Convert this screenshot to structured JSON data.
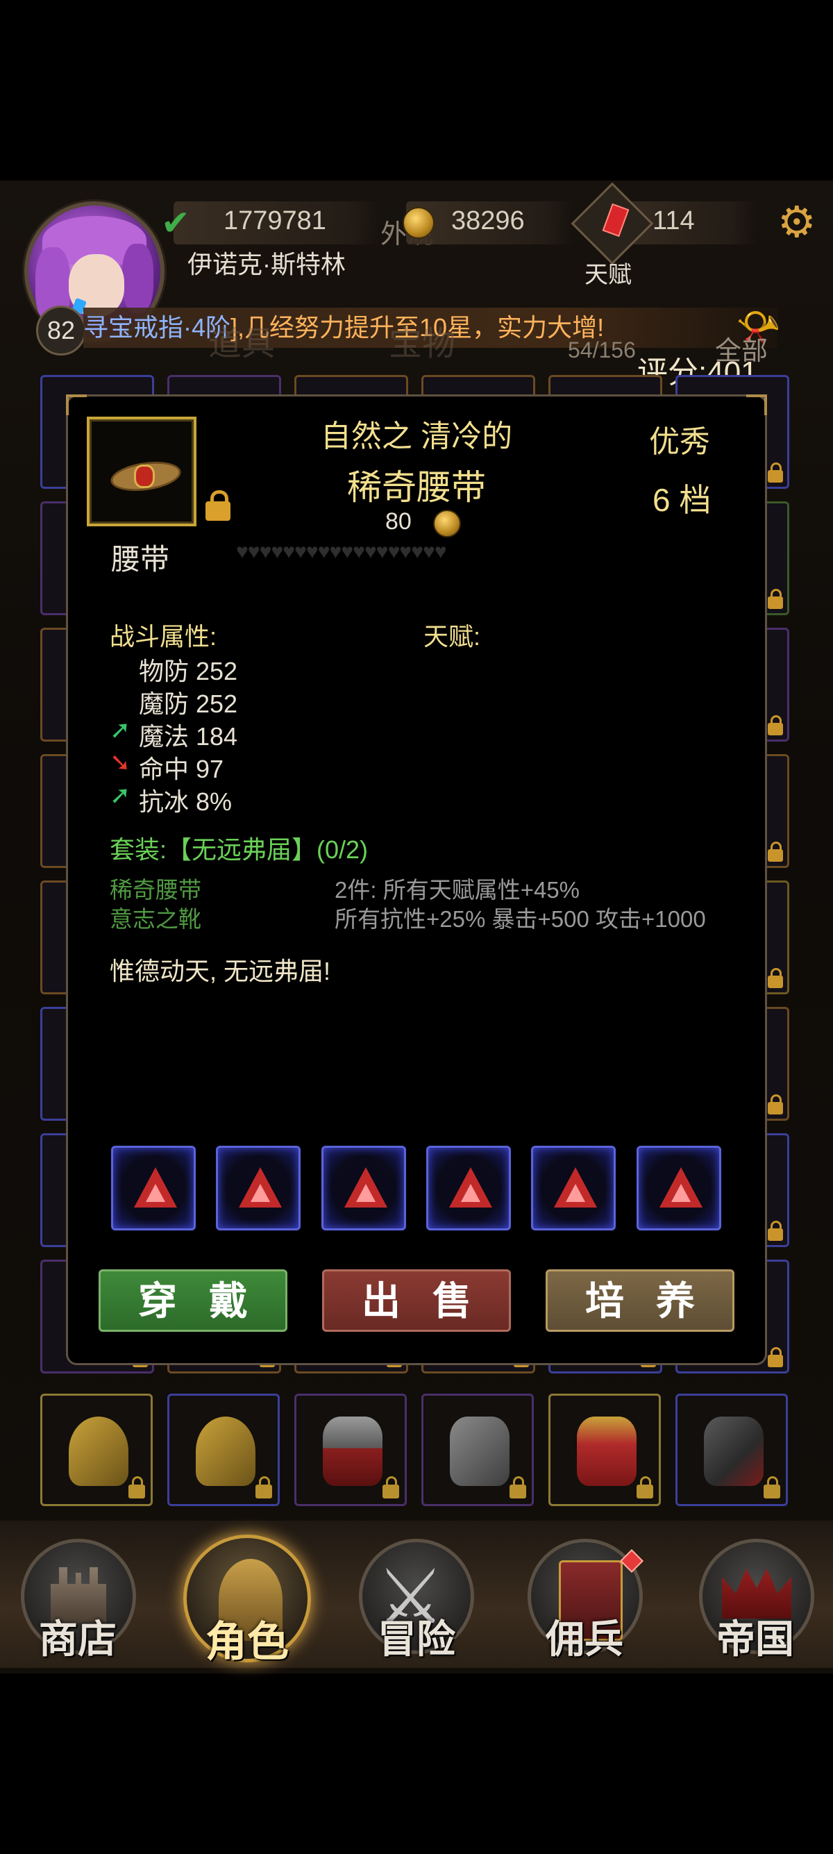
{
  "header": {
    "stamina_value": "1779781",
    "gold_value": "38296",
    "gem_value": "114",
    "player_name": "伊诺克·斯特林",
    "talent_label": "天赋",
    "level": "82",
    "ticker_part1": "寻宝戒指·4阶",
    "ticker_part2": "],几经努力提升至10星，实力大增!",
    "behind_appearance": "外观",
    "behind_tab1": "道具",
    "behind_tab2": "宝物",
    "inventory_count": "54/156",
    "filter_all": "全部",
    "score": "评分:401"
  },
  "item": {
    "prefix": "自然之 清冷的",
    "name": "稀奇腰带",
    "price": "80",
    "type": "腰带",
    "grade": "优秀",
    "tier": "6 档",
    "hearts": "♥♥♥♥♥♥♥♥♥♥♥♥♥♥♥♥♥♥",
    "combat_title": "战斗属性:",
    "talent_title": "天赋:",
    "stats": [
      {
        "label": "物防 252",
        "trend": "none"
      },
      {
        "label": "魔防 252",
        "trend": "none"
      },
      {
        "label": "魔法 184",
        "trend": "up"
      },
      {
        "label": "命中 97",
        "trend": "down"
      },
      {
        "label": "抗冰 8%",
        "trend": "up"
      }
    ],
    "set_title": "套装:【无远弗届】(0/2)",
    "set_items": [
      {
        "name": "稀奇腰带",
        "bonus": "2件: 所有天赋属性+45%"
      },
      {
        "name": "意志之靴",
        "bonus": "所有抗性+25% 暴击+500 攻击+1000"
      }
    ],
    "flavor": "惟德动天, 无远弗届!",
    "gem_slots": [
      "red-triangle-gem",
      "red-triangle-gem",
      "red-triangle-gem",
      "red-triangle-gem",
      "red-triangle-gem",
      "red-triangle-gem"
    ]
  },
  "actions": {
    "wear": "穿戴",
    "sell": "出售",
    "train": "培养"
  },
  "nav": {
    "shop": "商店",
    "character": "角色",
    "adventure": "冒险",
    "mercenary": "佣兵",
    "empire": "帝国"
  },
  "colors": {
    "gold_text": "#f2df8e",
    "set_green": "#6ad158",
    "stat_up": "#39c46a",
    "stat_down": "#e0362b",
    "gem_border": "#5b63d9"
  }
}
